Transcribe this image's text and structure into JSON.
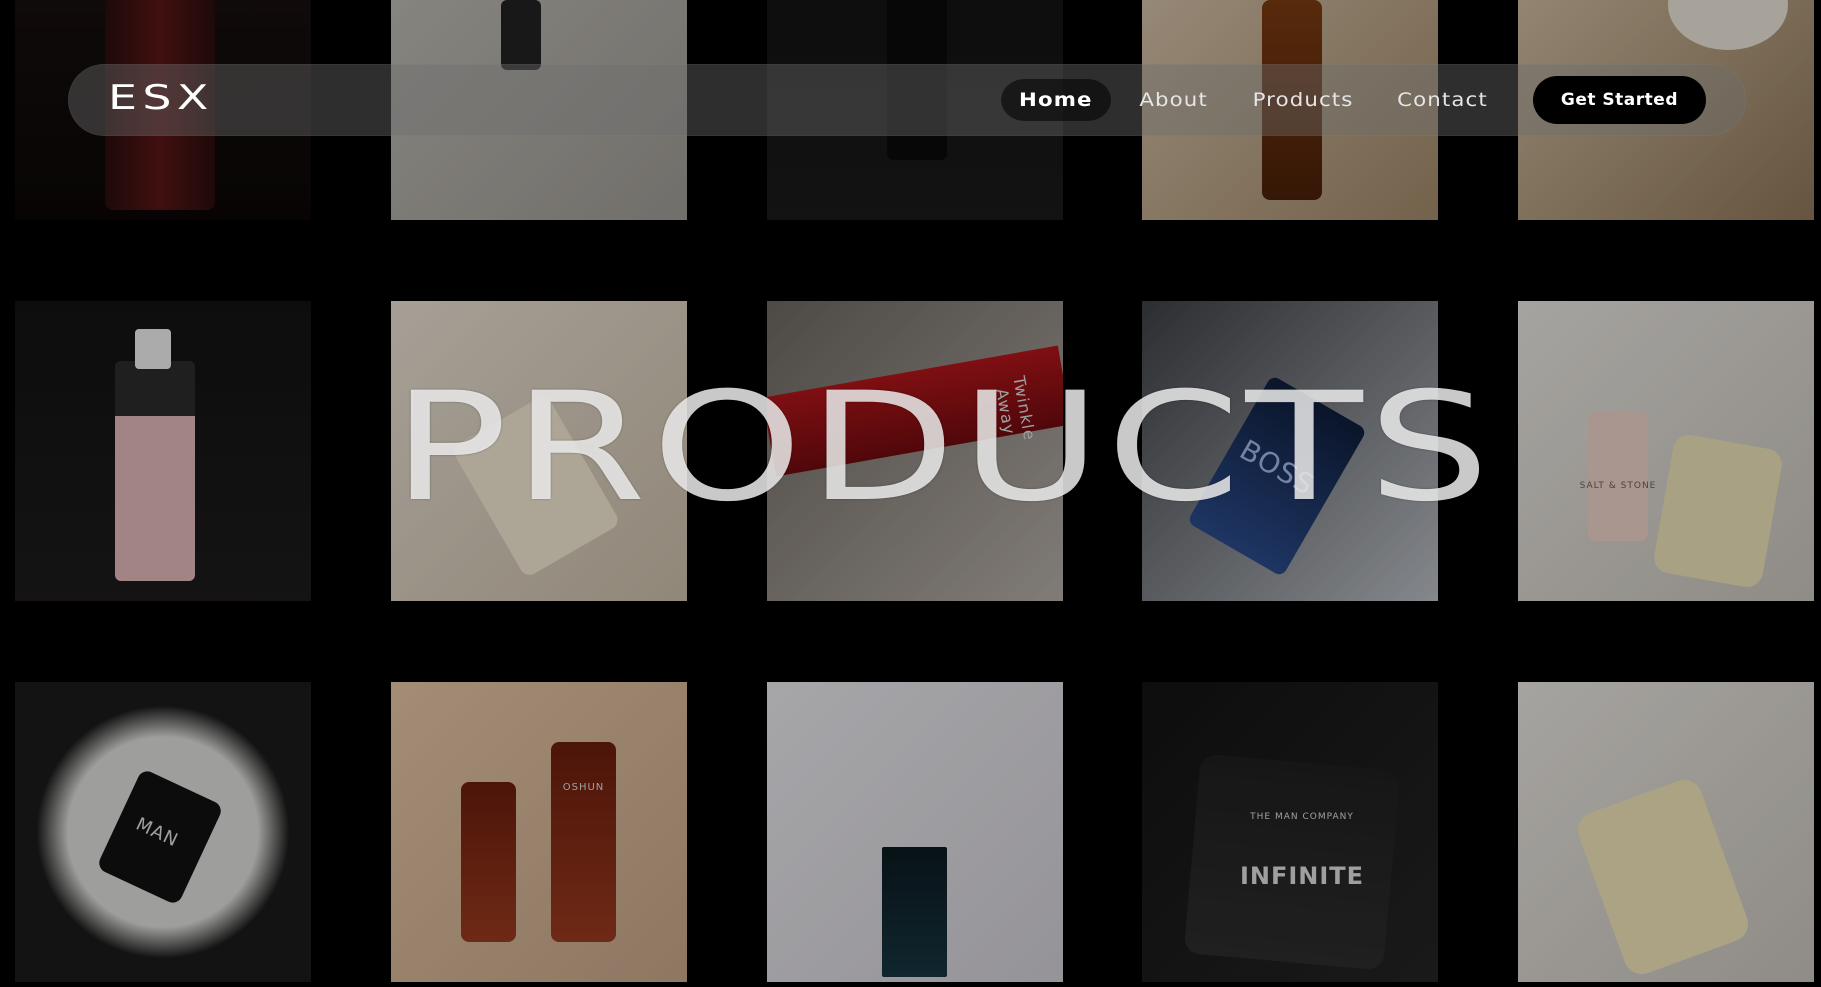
{
  "header": {
    "logo": "ESX",
    "nav": [
      {
        "label": "Home",
        "active": true
      },
      {
        "label": "About",
        "active": false
      },
      {
        "label": "Products",
        "active": false
      },
      {
        "label": "Contact",
        "active": false
      }
    ],
    "cta_label": "Get Started"
  },
  "hero": {
    "title": "PRODUCTS"
  },
  "tiles": {
    "bosd": "BOSS",
    "salt_stone": "SALT & STONE",
    "oshun": "OSHUN",
    "infinite": "INFINITE",
    "man_company": "THE MAN COMPANY",
    "twinkle": "Twinkle Away",
    "man": "MAN"
  },
  "colors": {
    "background": "#000000",
    "header_bg": "rgba(110,110,110,0.42)",
    "cta_bg": "#000000",
    "text": "#ffffff"
  }
}
